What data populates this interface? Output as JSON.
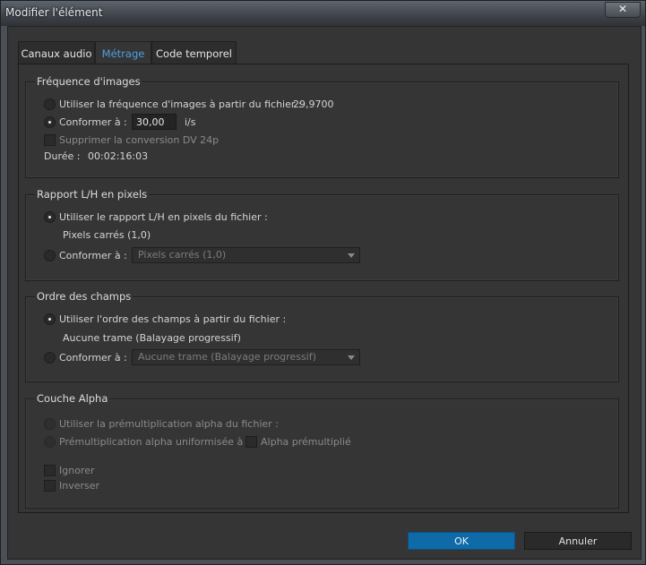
{
  "window": {
    "title": "Modifier l'élément",
    "close_glyph": "✕"
  },
  "tabs": [
    {
      "label": "Canaux audio",
      "active": false
    },
    {
      "label": "Métrage",
      "active": true
    },
    {
      "label": "Code temporel",
      "active": false
    }
  ],
  "frame_rate": {
    "title": "Fréquence d'images",
    "use_file_label": "Utiliser la fréquence d'images à partir du fichier :",
    "use_file_value": "29,9700",
    "conform_label": "Conformer à :",
    "conform_value": "30,00",
    "conform_unit": "i/s",
    "remove_pulldown_label": "Supprimer la conversion DV 24p",
    "duration_label": "Durée :",
    "duration_value": "00:02:16:03",
    "selected": "conform"
  },
  "pixel_aspect": {
    "title": "Rapport L/H en pixels",
    "use_file_label": "Utiliser le rapport L/H en pixels du fichier :",
    "file_value": "Pixels carrés (1,0)",
    "conform_label": "Conformer à :",
    "conform_selected": "Pixels carrés (1,0)",
    "selected": "use_file"
  },
  "field_order": {
    "title": "Ordre des champs",
    "use_file_label": "Utiliser l'ordre des champs à partir du fichier :",
    "file_value": "Aucune trame (Balayage progressif)",
    "conform_label": "Conformer à :",
    "conform_selected": "Aucune trame (Balayage progressif)",
    "selected": "use_file"
  },
  "alpha": {
    "title": "Couche Alpha",
    "use_file_label": "Utiliser la prémultiplication alpha du fichier :",
    "uniform_label": "Prémultiplication alpha uniformisée à :",
    "premultiplied_label": "Alpha prémultiplié",
    "ignore_label": "Ignorer",
    "invert_label": "Inverser"
  },
  "buttons": {
    "ok": "OK",
    "cancel": "Annuler"
  },
  "colors": {
    "accent": "#0f6aa8",
    "active_tab_text": "#4ea0e0",
    "background": "#353535"
  }
}
